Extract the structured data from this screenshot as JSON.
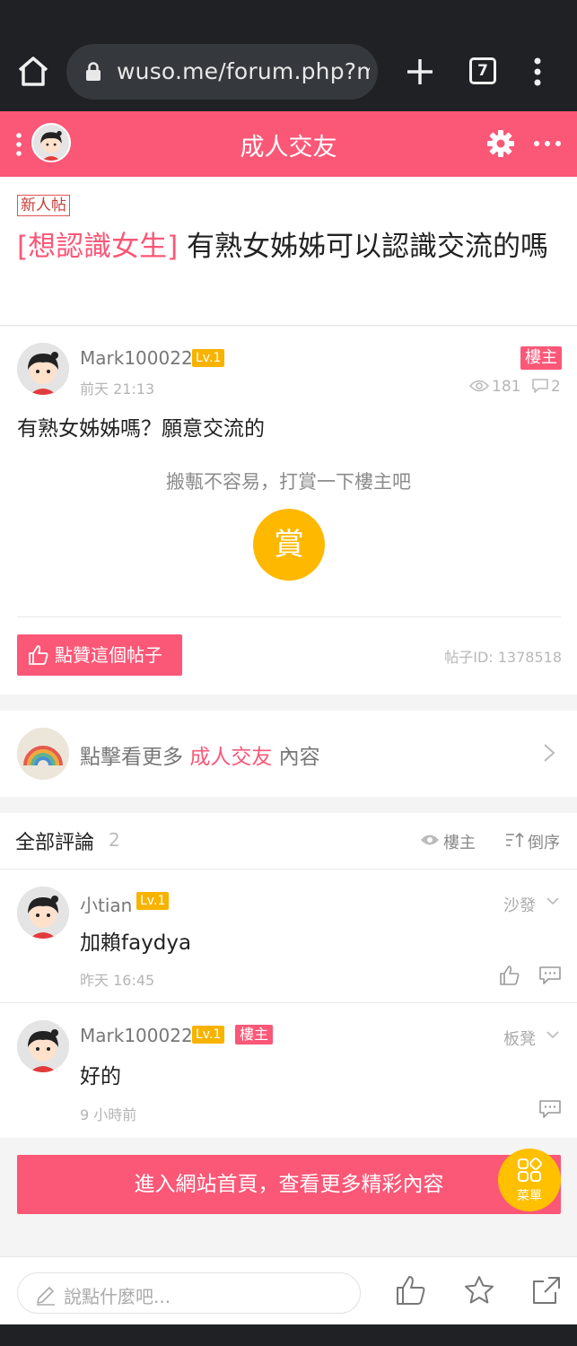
{
  "browser": {
    "url": "wuso.me/forum.php?mod=viewthread",
    "tab_count": "7"
  },
  "header": {
    "title": "成人交友"
  },
  "post": {
    "tag": "新人帖",
    "category": "[想認識女生]",
    "title": " 有熟女姊姊可以認識交流的嗎",
    "author": "Mark100022",
    "level": "Lv.1",
    "owner_label": "樓主",
    "time": "前天 21:13",
    "views": "181",
    "replies": "2",
    "content": "有熟女姊姊嗎？願意交流的",
    "reward_prompt": "搬甎不容易，打賞一下樓主吧",
    "reward_button": "賞",
    "like_label": "點贊這個帖子",
    "post_id": "帖子ID: 1378518"
  },
  "more_link": {
    "prefix": "點擊看更多 ",
    "forum": "成人交友",
    "suffix": " 內容"
  },
  "comments_section": {
    "title": "全部評論",
    "count": "2",
    "filter_owner": "樓主",
    "sort_reverse": "倒序"
  },
  "comments": [
    {
      "author": "小tian",
      "level": "Lv.1",
      "floor": "沙發",
      "content": "加賴faydya",
      "time": "昨天 16:45"
    },
    {
      "author": "Mark100022",
      "level": "Lv.1",
      "owner_badge": "樓主",
      "floor": "板凳",
      "content": "好的",
      "time": "9 小時前"
    }
  ],
  "banner": {
    "label": "進入網站首頁，查看更多精彩內容",
    "menu_label": "菜單"
  },
  "comment_bar": {
    "placeholder": "說點什麼吧..."
  },
  "colors": {
    "brand": "#fb5777",
    "level": "#f8b300",
    "reward": "#ffb800"
  },
  "icons": [
    "home-icon",
    "lock-icon",
    "plus-icon",
    "tabs-icon",
    "kebab-icon",
    "menu-dots-icon",
    "gear-icon",
    "more-icon",
    "eye-icon",
    "comment-icon",
    "thumb-up-icon",
    "chevron-right-icon",
    "chevron-down-icon",
    "sort-icon",
    "pen-icon",
    "star-icon",
    "share-icon",
    "grid-icon"
  ]
}
